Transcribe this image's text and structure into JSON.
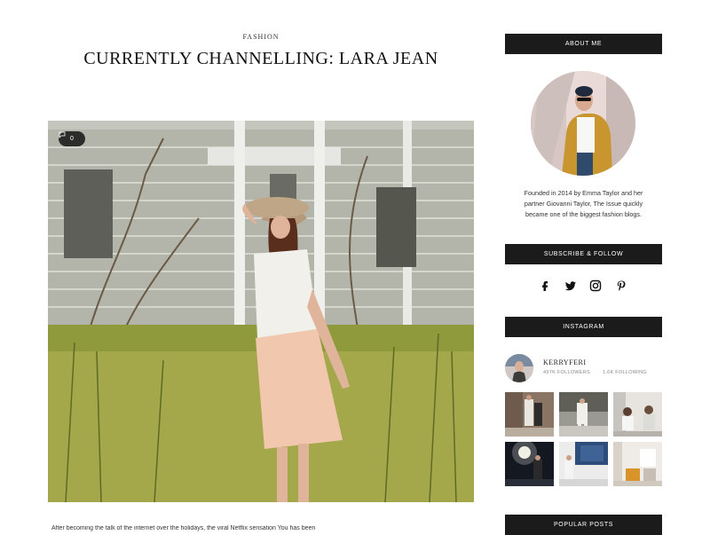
{
  "post": {
    "category": "FASHION",
    "title": "CURRENTLY CHANNELLING: LARA JEAN",
    "comment_count": "0",
    "excerpt": "After becoming the talk of the internet over the holidays, the viral Netflix sensation You has been"
  },
  "sidebar": {
    "about": {
      "title": "ABOUT ME",
      "text": "Founded in 2014 by Emma Taylor and her partner Giovanni Taylor, The Issue quickly became one of the biggest fashion blogs."
    },
    "subscribe": {
      "title": "SUBSCRIBE & FOLLOW",
      "icons": [
        "facebook-icon",
        "twitter-icon",
        "instagram-icon",
        "pinterest-icon"
      ]
    },
    "instagram": {
      "title": "INSTAGRAM",
      "username": "KERRYFERI",
      "followers": "497K FOLLOWERS",
      "following": "1.6K FOLLOWING",
      "photos": [
        "instagram-photo-1",
        "instagram-photo-2",
        "instagram-photo-3",
        "instagram-photo-4",
        "instagram-photo-5",
        "instagram-photo-6"
      ]
    },
    "popular": {
      "title": "POPULAR POSTS"
    }
  },
  "colors": {
    "widget_bar": "#1b1b1b",
    "text": "#222222",
    "muted": "#888888"
  }
}
